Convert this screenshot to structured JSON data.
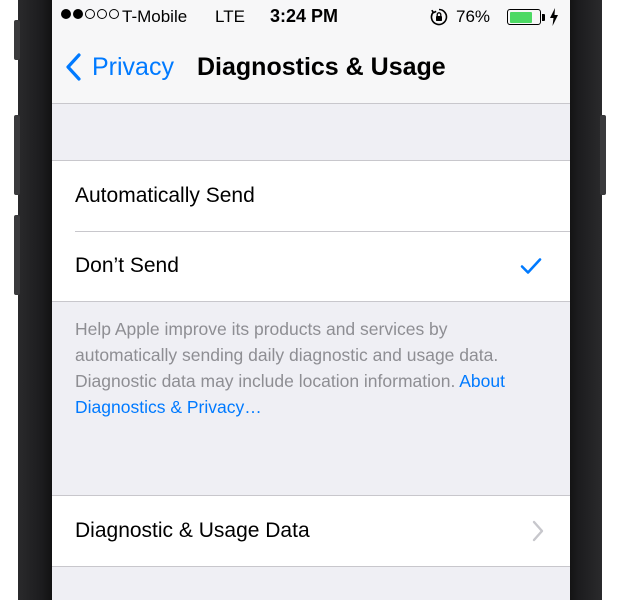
{
  "status_bar": {
    "carrier": "T-Mobile",
    "network": "LTE",
    "time": "3:24 PM",
    "battery_percent": "76%",
    "battery_level": 0.76,
    "signal_strength": 2,
    "signal_total": 5,
    "rotation_lock_icon": "rotation-lock-icon",
    "charging_icon": "bolt-icon"
  },
  "nav": {
    "back_label": "Privacy",
    "title": "Diagnostics & Usage"
  },
  "send_options": {
    "items": [
      {
        "label": "Automatically Send",
        "selected": false
      },
      {
        "label": "Don’t Send",
        "selected": true
      }
    ]
  },
  "footer": {
    "text": "Help Apple improve its products and services by automatically sending daily diagnostic and usage data. Diagnostic data may include location information.",
    "link": "About Diagnostics & Privacy…"
  },
  "data_group": {
    "items": [
      {
        "label": "Diagnostic & Usage Data"
      }
    ]
  },
  "colors": {
    "accent": "#007aff",
    "battery": "#4cd964",
    "secondary_text": "#8e8e93",
    "background": "#efeff4"
  }
}
